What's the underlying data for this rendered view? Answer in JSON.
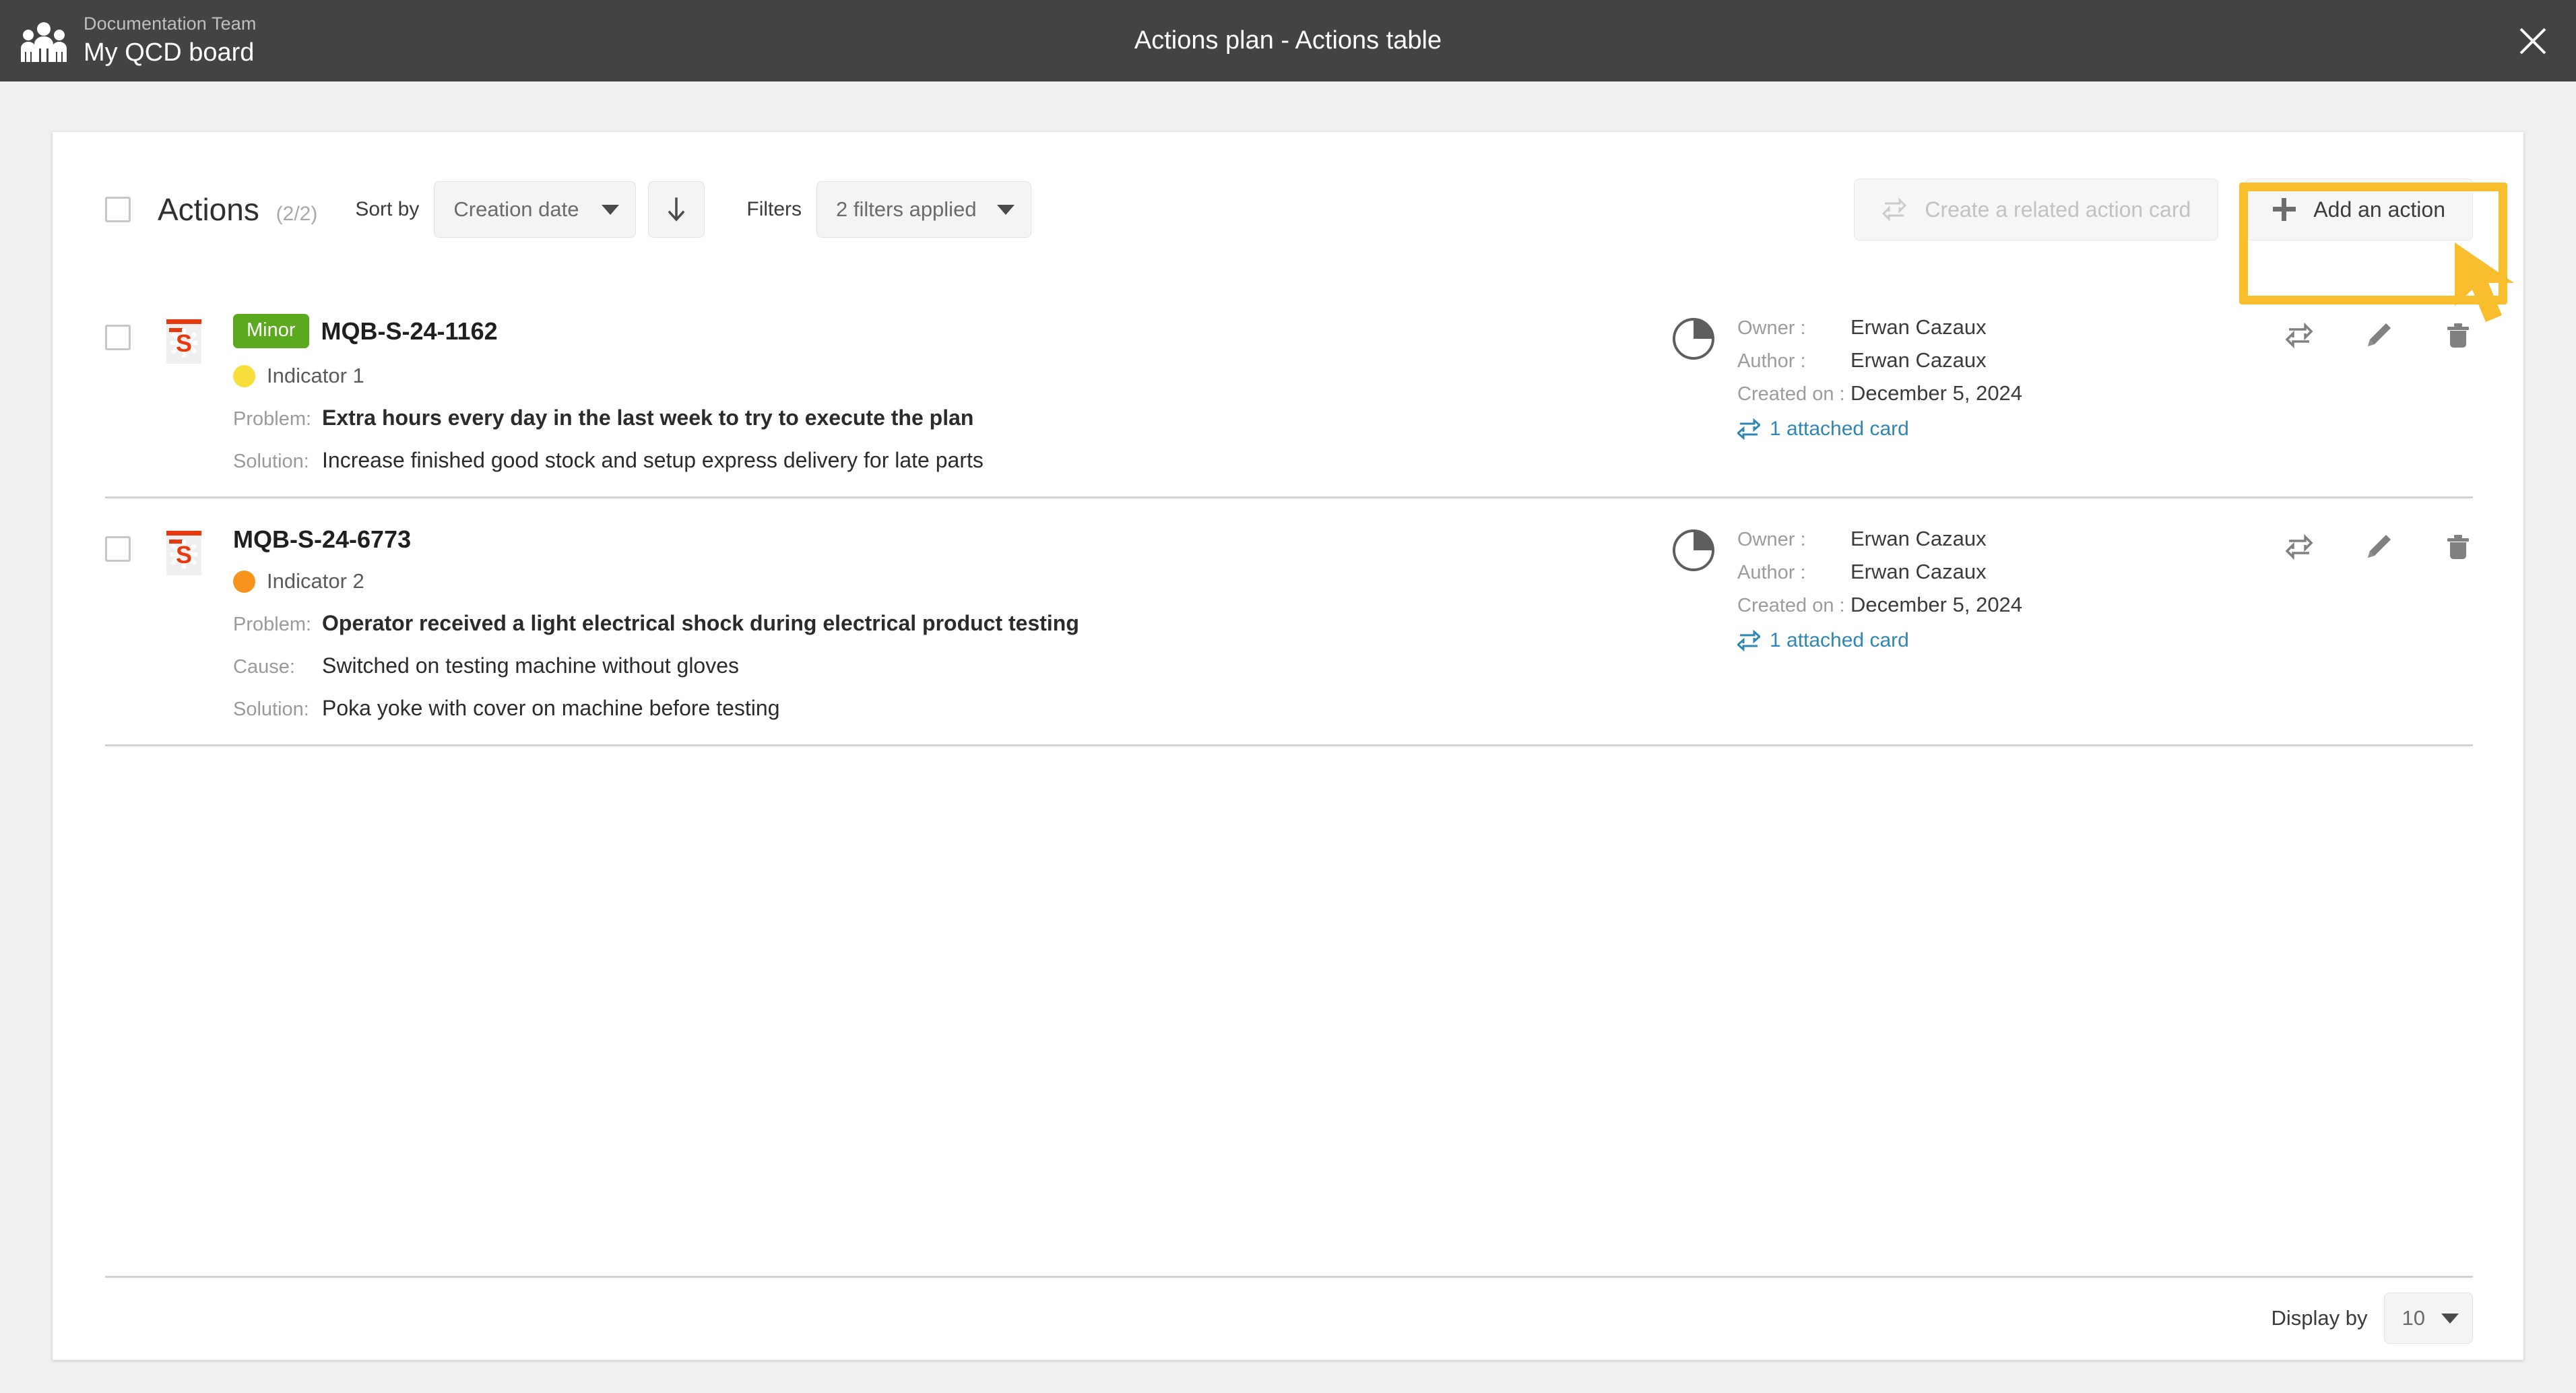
{
  "topbar": {
    "team_label": "Documentation Team",
    "board_title": "My QCD board",
    "window_title": "Actions plan - Actions table",
    "close_icon": "close-icon",
    "team_icon": "team-people-icon"
  },
  "toolbar": {
    "select_all_checkbox": "",
    "title": "Actions",
    "count": "(2/2)",
    "sort_by_label": "Sort by",
    "sort_by_value": "Creation date",
    "sort_direction_icon": "arrow-down-icon",
    "filters_label": "Filters",
    "filters_value": "2 filters applied",
    "create_related_label": "Create a related action card",
    "create_related_icon": "repeat-icon",
    "add_action_label": "Add an action",
    "add_action_icon": "plus-icon"
  },
  "highlight": {
    "color": "#f9be2e",
    "cursor_color": "#f9be2e"
  },
  "colors": {
    "badge_minor": "#5ba91f",
    "indicator_yellow": "#f7de3a",
    "indicator_orange": "#f7941e",
    "link_blue": "#2e86b5",
    "topbar_bg": "#434343",
    "page_bg": "#f0f0f0",
    "qcd_red": "#e8380d"
  },
  "rows": [
    {
      "checkbox": "",
      "qcd_icon": "safety-s-icon",
      "badge": "Minor",
      "has_badge": true,
      "reference": "MQB-S-24-1162",
      "indicator_color": "#f7de3a",
      "indicator_label": "Indicator 1",
      "fields": [
        {
          "label": "Problem:",
          "value": "Extra hours every day in the last week to try to execute the plan",
          "bold": true
        },
        {
          "label": "Solution:",
          "value": "Increase finished good stock and setup express delivery for late parts",
          "bold": false
        }
      ],
      "meta": [
        {
          "key": "Owner :",
          "value": "Erwan Cazaux"
        },
        {
          "key": "Author :",
          "value": "Erwan Cazaux"
        },
        {
          "key": "Created on :",
          "value": "December 5, 2024"
        }
      ],
      "attached_label": "1 attached card",
      "attached_icon": "attached-card-icon",
      "actions": [
        "link-action-icon",
        "edit-pencil-icon",
        "delete-trash-icon"
      ]
    },
    {
      "checkbox": "",
      "qcd_icon": "safety-s-icon",
      "badge": "",
      "has_badge": false,
      "reference": "MQB-S-24-6773",
      "indicator_color": "#f7941e",
      "indicator_label": "Indicator 2",
      "fields": [
        {
          "label": "Problem:",
          "value": "Operator received a light electrical shock during electrical product testing",
          "bold": true
        },
        {
          "label": "Cause:",
          "value": "Switched on testing machine without gloves",
          "bold": false
        },
        {
          "label": "Solution:",
          "value": "Poka yoke with cover on machine before testing",
          "bold": false
        }
      ],
      "meta": [
        {
          "key": "Owner :",
          "value": "Erwan Cazaux"
        },
        {
          "key": "Author :",
          "value": "Erwan Cazaux"
        },
        {
          "key": "Created on :",
          "value": "December 5, 2024"
        }
      ],
      "attached_label": "1 attached card",
      "attached_icon": "attached-card-icon",
      "actions": [
        "link-action-icon",
        "edit-pencil-icon",
        "delete-trash-icon"
      ]
    }
  ],
  "footer": {
    "display_by_label": "Display by",
    "display_by_value": "10"
  }
}
